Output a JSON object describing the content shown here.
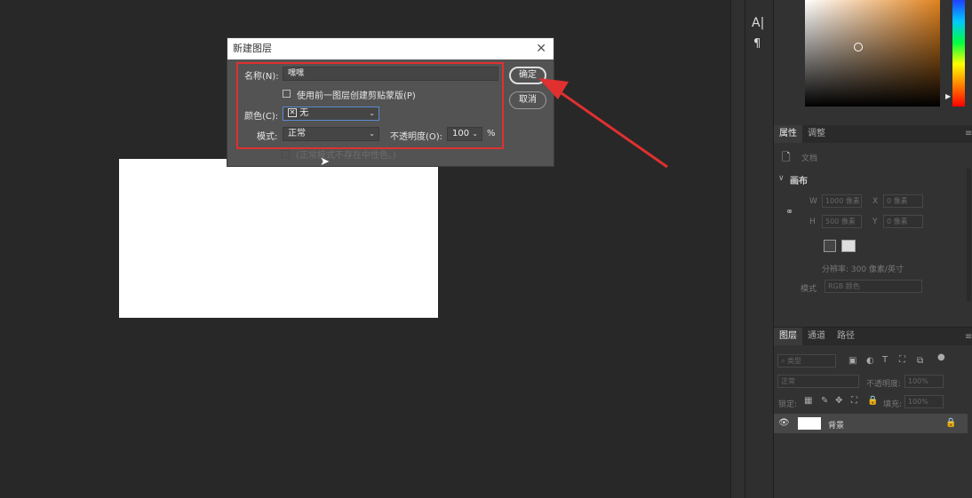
{
  "dialog": {
    "title": "新建图层",
    "close": "✕",
    "name_label": "名称(N):",
    "name_value": "嘿嘿",
    "clip_label": "使用前一图层创建剪贴蒙版(P)",
    "color_label": "颜色(C):",
    "color_value": "无",
    "mode_label": "模式:",
    "mode_value": "正常",
    "opacity_label": "不透明度(O):",
    "opacity_value": "100",
    "opacity_unit": "%",
    "ok": "确定",
    "cancel": "取消",
    "neutral_note": "(正常模式不存在中性色。)"
  },
  "toolbar": {
    "type_tool": "A|",
    "para_tool": "¶"
  },
  "properties": {
    "tab_props": "属性",
    "tab_adjust": "调整",
    "doc_label": "文档",
    "canvas_heading": "画布",
    "w_label": "W",
    "w_value": "1000 像素",
    "h_label": "H",
    "h_value": "500 像素",
    "x_label": "X",
    "x_value": "0 像素",
    "y_label": "Y",
    "y_value": "0 像素",
    "resolution": "分辨率: 300 像素/英寸",
    "mode_label": "模式",
    "mode_value": "RGB 颜色"
  },
  "layers": {
    "tab_layers": "图层",
    "tab_channels": "通道",
    "tab_paths": "路径",
    "filter_type": "类型",
    "blend": "正常",
    "opacity_label": "不透明度:",
    "opacity_value": "100%",
    "lock_label": "锁定:",
    "fill_label": "填充:",
    "fill_value": "100%",
    "layer_name": "背景"
  },
  "colors": {
    "annotation": "#e03030",
    "canvas": "#ffffff",
    "workspace": "#282828"
  }
}
